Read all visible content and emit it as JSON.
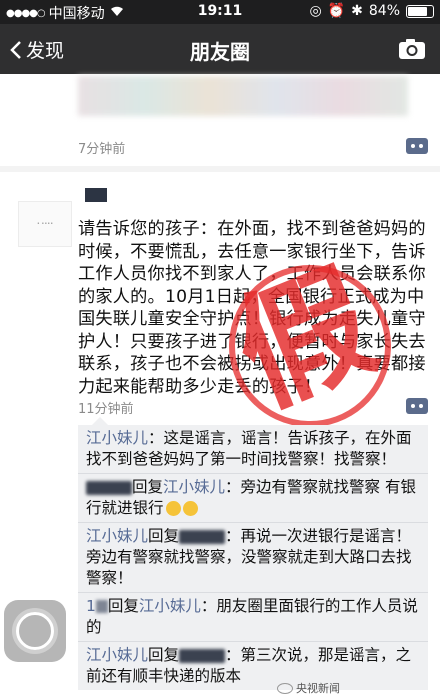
{
  "status": {
    "carrier": "中国移动",
    "time": "19:11",
    "battery": "84%"
  },
  "nav": {
    "back_label": "发现",
    "title": "朋友圈"
  },
  "post1": {
    "time": "7分钟前"
  },
  "post2": {
    "text": "请告诉您的孩子：在外面，找不到爸爸妈妈的时候，不要慌乱，去任意一家银行坐下，告诉工作人员你找不到家人了，工作人员会联系你的家人的。10月1日起，全国银行正式成为中国失联儿童安全守护点！银行成为走失儿童守护人！只要孩子进了银行，便暂时与家长失去联系，孩子也不会被拐或出现意外！真要都接力起来能帮助多少走丢的孩子！",
    "time": "11分钟前",
    "stamp": "假",
    "comments": [
      {
        "name": "江小妹儿",
        "text": "：这是谣言，谣言！告诉孩子，在外面找不到爸爸妈妈了第一时间找警察！找警察！"
      },
      {
        "reply": "回复",
        "to": "江小妹儿",
        "text": "：旁边有警察就找警察 有银行就进银行"
      },
      {
        "name": "江小妹儿",
        "reply": "回复",
        "text": "：再说一次进银行是谣言！旁边有警察就找警察，没警察就走到大路口去找警察！"
      },
      {
        "prefix": "1",
        "reply": "回复",
        "to": "江小妹儿",
        "text": "：朋友圈里面银行的工作人员说的"
      },
      {
        "name": "江小妹儿",
        "reply": "回复",
        "text": "：第三次说，那是谣言，之前还有顺丰快递的版本"
      }
    ]
  },
  "watermark": "央视新闻"
}
